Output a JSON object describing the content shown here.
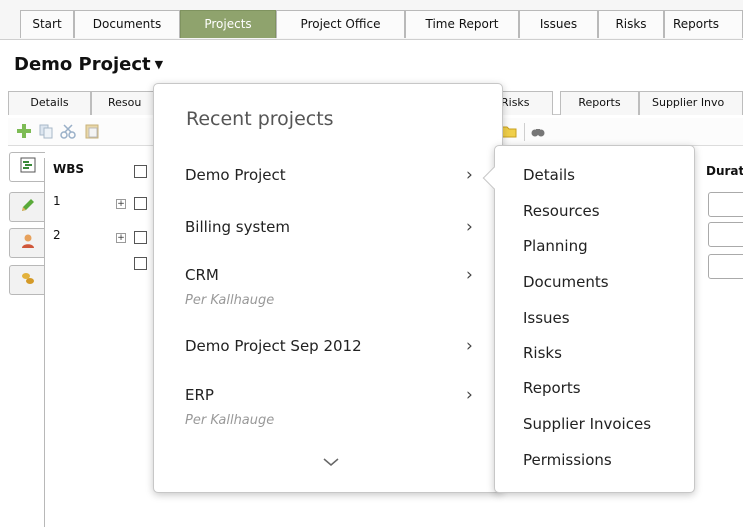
{
  "topnav": {
    "tabs": [
      "Start",
      "Documents",
      "Projects",
      "Project Office",
      "Time Report",
      "Issues",
      "Risks",
      "Reports"
    ],
    "active": "Projects",
    "active_color": "#8fa36d"
  },
  "project": {
    "title": "Demo Project"
  },
  "subnav": {
    "tabs": [
      "Details",
      "Resou",
      "Risks",
      "Reports",
      "Supplier Invo"
    ]
  },
  "wbs": {
    "header": "WBS",
    "rows": [
      "1",
      "2"
    ],
    "duration_header": "Durat"
  },
  "menu": {
    "title": "Recent projects",
    "projects": [
      {
        "name": "Demo Project",
        "owner": ""
      },
      {
        "name": "Billing system",
        "owner": ""
      },
      {
        "name": "CRM",
        "owner": "Per Kallhauge"
      },
      {
        "name": "Demo Project Sep 2012",
        "owner": ""
      },
      {
        "name": "ERP",
        "owner": "Per Kallhauge"
      }
    ]
  },
  "submenu": {
    "items": [
      "Details",
      "Resources",
      "Planning",
      "Documents",
      "Issues",
      "Risks",
      "Reports",
      "Supplier Invoices",
      "Permissions"
    ]
  },
  "icons": {
    "toolbar": [
      "add-icon",
      "copy-icon",
      "cut-icon",
      "paste-icon",
      "checkbox-icon",
      "person-icon",
      "diamond-icon",
      "circle-icon",
      "pencil-icon",
      "folder-icon",
      "binoculars-icon"
    ],
    "side_tabs": [
      "wbs-list-icon",
      "pencil-icon",
      "person-icon",
      "coins-icon"
    ]
  }
}
